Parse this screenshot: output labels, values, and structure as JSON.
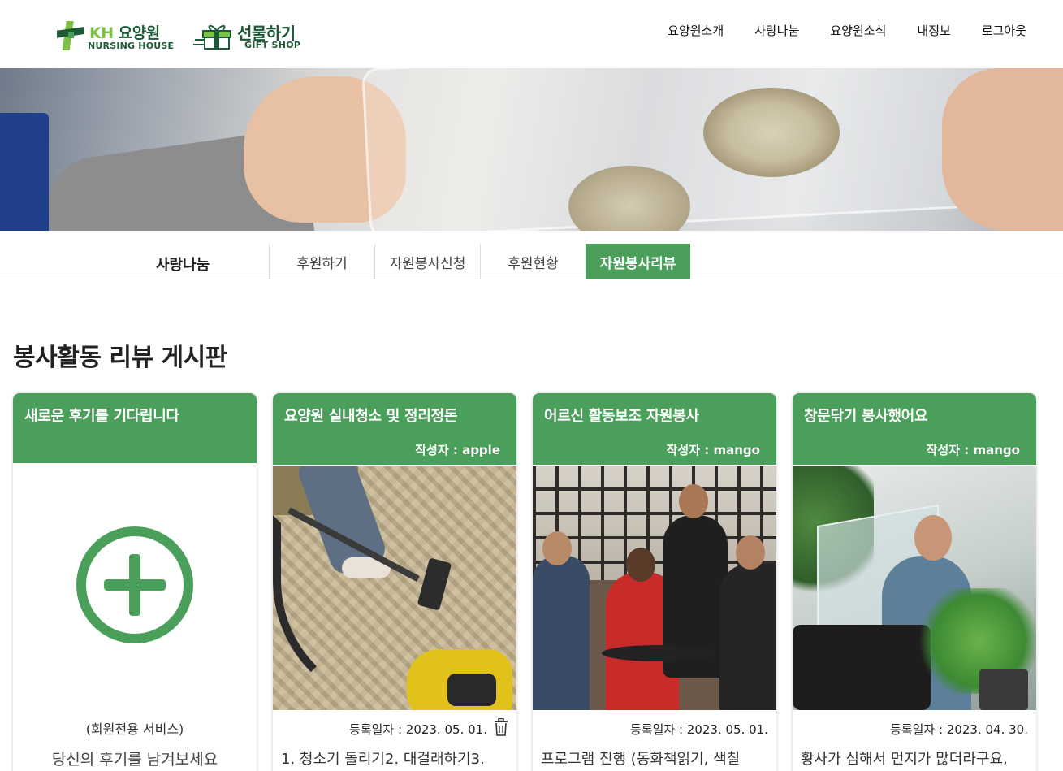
{
  "header": {
    "logo_kh": {
      "main_prefix": "KH",
      "main": " 요양원",
      "sub": "NURSING HOUSE"
    },
    "logo_gift": {
      "main": "선물하기",
      "sub": "GIFT SHOP"
    },
    "nav": [
      "요양원소개",
      "사랑나눔",
      "요양원소식",
      "내정보",
      "로그아웃"
    ]
  },
  "subnav": {
    "section_title": "사랑나눔",
    "tabs": [
      "후원하기",
      "자원봉사신청",
      "후원현황",
      "자원봉사리뷰"
    ],
    "active_tab": "자원봉사리뷰"
  },
  "page_title": "봉사활동 리뷰 게시판",
  "new_card": {
    "title": "새로운 후기를 기다립니다",
    "member_only": "(회원전용 서비스)",
    "cta": "당신의 후기를 남겨보세요",
    "icon": "plus-circle-icon"
  },
  "reviews": [
    {
      "title": "요양원 실내청소 및 정리정돈",
      "author": "작성자 : apple",
      "date": "등록일자 : 2023. 05. 01.",
      "excerpt": "1. 청소기 돌리기2. 대걸래하기3.",
      "has_delete": true
    },
    {
      "title": "어르신 활동보조 자원봉사",
      "author": "작성자 : mango",
      "date": "등록일자 : 2023. 05. 01.",
      "excerpt": "프로그램 진행 (동화책읽기, 색칠",
      "has_delete": false
    },
    {
      "title": "창문닦기 봉사했어요",
      "author": "작성자 : mango",
      "date": "등록일자 : 2023. 04. 30.",
      "excerpt": "황사가 심해서 먼지가 많더라구요,",
      "has_delete": false
    }
  ],
  "colors": {
    "primary_green": "#4a9f5a",
    "logo_dark_green": "#1d5a36",
    "logo_light_green": "#7cc242"
  }
}
